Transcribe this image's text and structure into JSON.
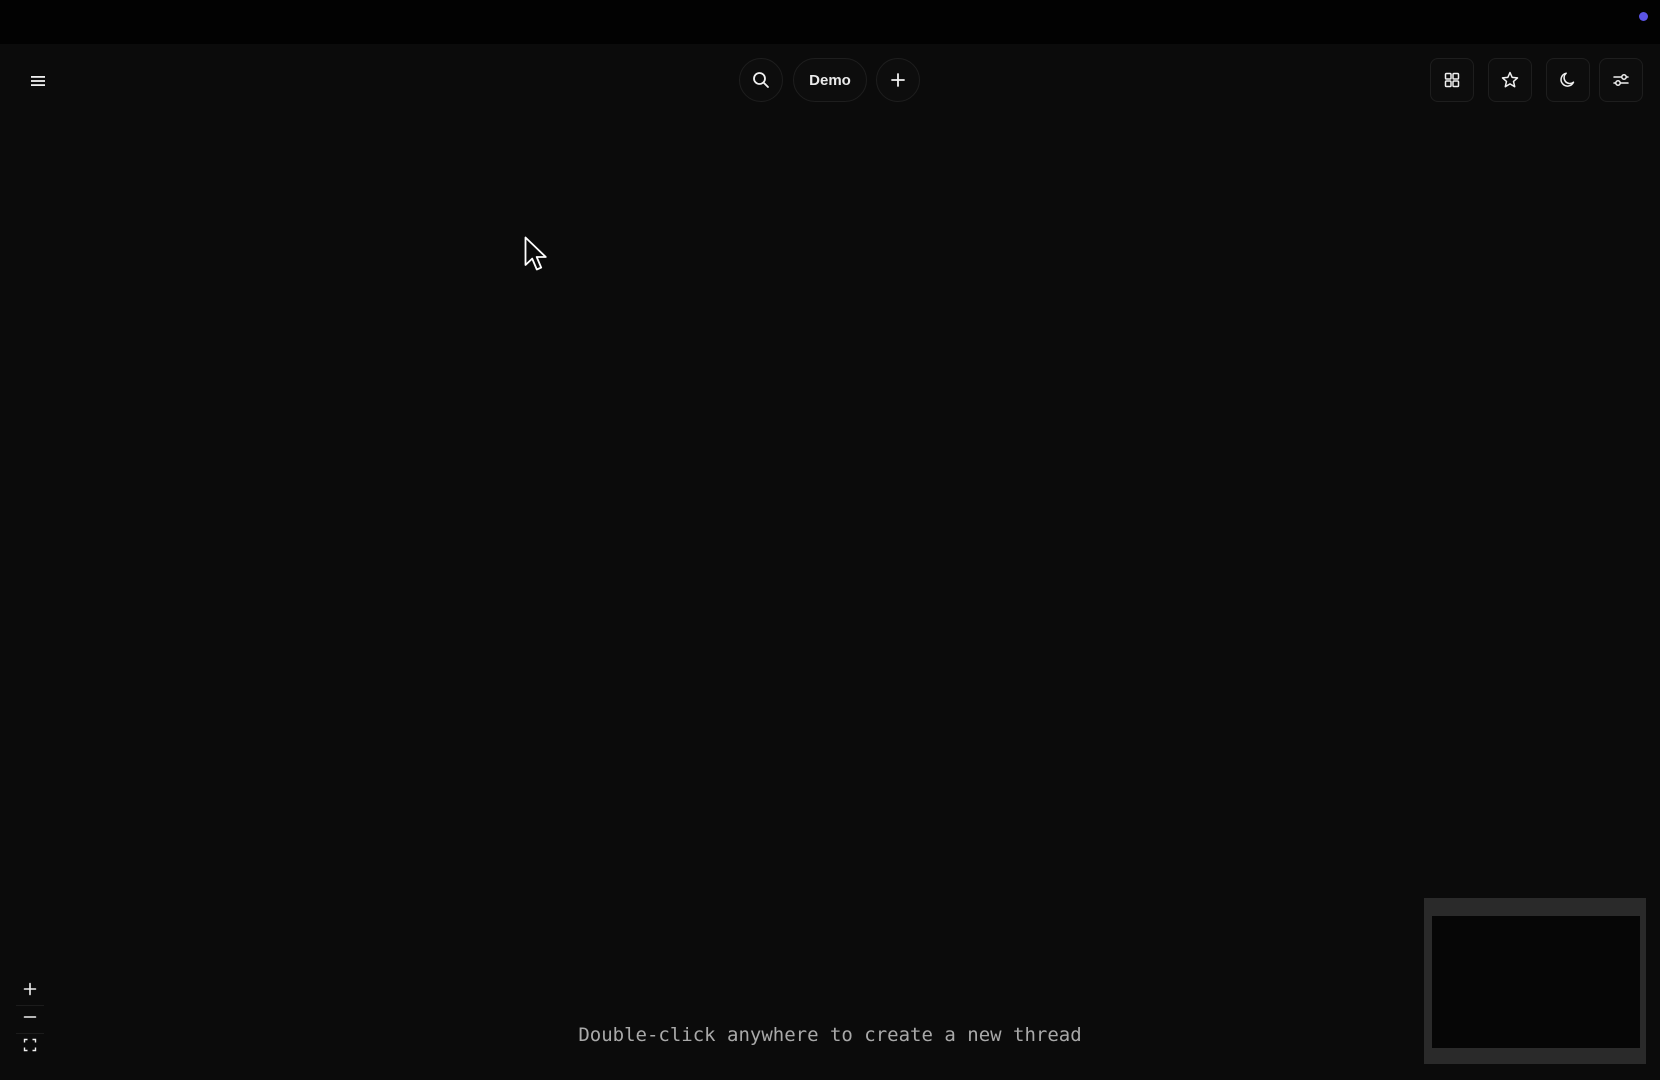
{
  "toolbar": {
    "project_name": "Demo"
  },
  "canvas": {
    "hint": "Double-click anywhere to create a new thread"
  },
  "icons": {
    "menu": "menu-icon",
    "search": "search-icon",
    "add": "plus-icon",
    "grid": "grid-icon",
    "star": "star-icon",
    "theme": "moon-icon",
    "settings": "sliders-icon",
    "zoom_in": "plus-icon",
    "zoom_out": "minus-icon",
    "fit": "fit-screen-icon"
  },
  "colors": {
    "background": "#0b0b0b",
    "status_dot": "#5b54e6",
    "hint_text": "#a9a9a9"
  }
}
